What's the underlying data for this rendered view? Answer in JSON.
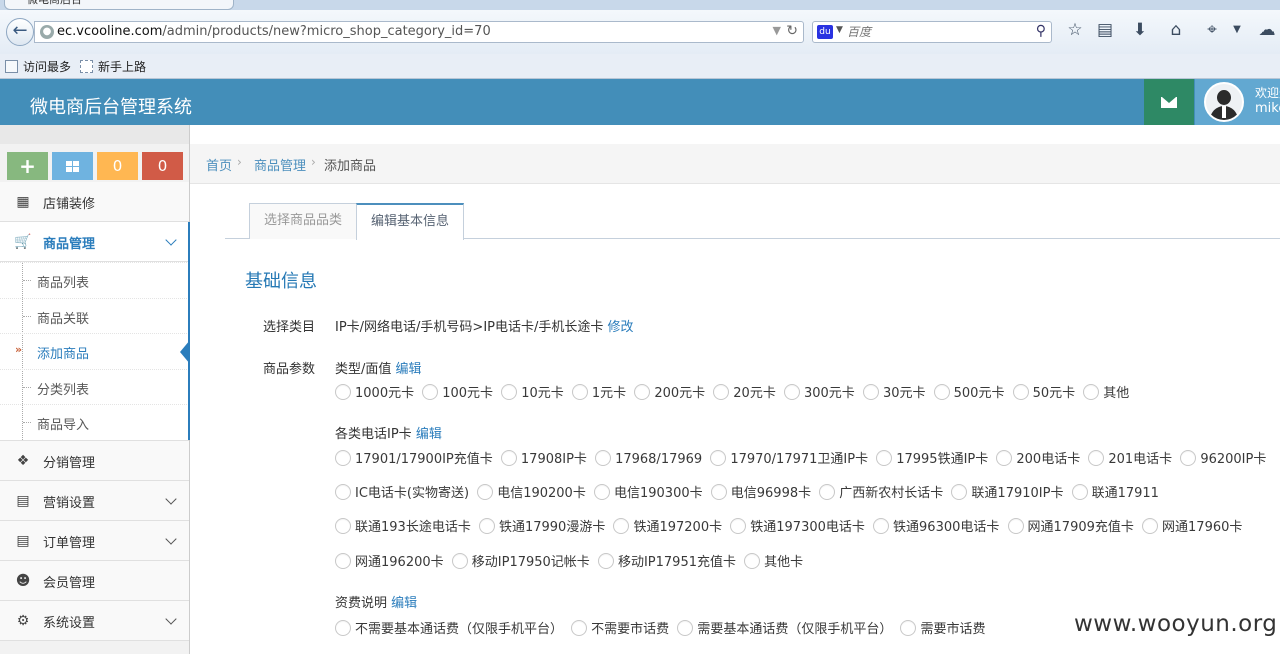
{
  "browser": {
    "tab_title": "微电商后台",
    "url_host": "ec.vcooline.com",
    "url_path": "/admin/products/new?micro_shop_category_id=70",
    "search_placeholder": "百度",
    "bookmarks": [
      "访问最多",
      "新手上路"
    ]
  },
  "header": {
    "title": "微电商后台管理系统",
    "welcome": "欢迎光临,",
    "username": "mike"
  },
  "shortcuts": {
    "orange_count": "0",
    "red_count": "0"
  },
  "sidebar": {
    "items": [
      {
        "label": "店铺装修",
        "icon": "grid-icon"
      },
      {
        "label": "商品管理",
        "icon": "cart-icon"
      },
      {
        "label": "分销管理",
        "icon": "share-icon"
      },
      {
        "label": "营销设置",
        "icon": "document-icon"
      },
      {
        "label": "订单管理",
        "icon": "document-icon"
      },
      {
        "label": "会员管理",
        "icon": "users-icon"
      },
      {
        "label": "系统设置",
        "icon": "gear-icon"
      }
    ],
    "sub_items": [
      "商品列表",
      "商品关联",
      "添加商品",
      "分类列表",
      "商品导入"
    ]
  },
  "breadcrumb": {
    "home": "首页",
    "section": "商品管理",
    "current": "添加商品"
  },
  "tabs": [
    "选择商品品类",
    "编辑基本信息"
  ],
  "form": {
    "section_title": "基础信息",
    "category_label": "选择类目",
    "category_value": "IP卡/网络电话/手机号码>IP电话卡/手机长途卡",
    "modify_link": "修改",
    "params_label": "商品参数",
    "edit_link": "编辑",
    "groups": [
      {
        "title": "类型/面值",
        "options": [
          [
            "1000元卡",
            "100元卡",
            "10元卡",
            "1元卡",
            "200元卡",
            "20元卡",
            "300元卡",
            "30元卡",
            "500元卡",
            "50元卡",
            "其他"
          ]
        ]
      },
      {
        "title": "各类电话IP卡",
        "options": [
          [
            "17901/17900IP充值卡",
            "17908IP卡",
            "17968/17969",
            "17970/17971卫通IP卡",
            "17995铁通IP卡",
            "200电话卡",
            "201电话卡",
            "96200IP卡"
          ],
          [
            "IC电话卡(实物寄送)",
            "电信190200卡",
            "电信190300卡",
            "电信96998卡",
            "广西新农村长话卡",
            "联通17910IP卡",
            "联通17911"
          ],
          [
            "联通193长途电话卡",
            "铁通17990漫游卡",
            "铁通197200卡",
            "铁通197300电话卡",
            "铁通96300电话卡",
            "网通17909充值卡",
            "网通17960卡"
          ],
          [
            "网通196200卡",
            "移动IP17950记帐卡",
            "移动IP17951充值卡",
            "其他卡"
          ]
        ]
      },
      {
        "title": "资费说明",
        "options": [
          [
            "不需要基本通话费（仅限手机平台）",
            "不需要市话费",
            "需要基本通话费（仅限手机平台）",
            "需要市话费"
          ]
        ]
      }
    ]
  },
  "watermark": "www.wooyun.org",
  "colors": {
    "header": "#438eb9",
    "accent": "#2b7dbc",
    "mail": "#2e8965"
  }
}
